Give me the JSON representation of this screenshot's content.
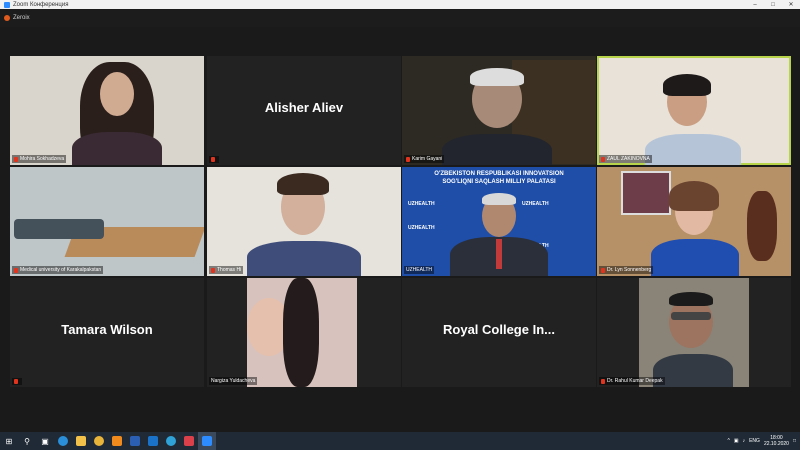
{
  "window": {
    "title": "Zoom Конференция"
  },
  "topbar": {
    "label": "Zeroix"
  },
  "participants": [
    {
      "name": "Mohira Sokhadzeva",
      "display": ""
    },
    {
      "name": "",
      "display": "Alisher Aliev"
    },
    {
      "name": "Karim Gayani",
      "display": ""
    },
    {
      "name": "ZAUL ZAKINOVNA",
      "display": ""
    },
    {
      "name": "Medical university of Karakalpakstan",
      "display": ""
    },
    {
      "name": "Thomas Hi",
      "display": ""
    },
    {
      "name": "UZHEALTH",
      "display": ""
    },
    {
      "name": "Dr. Lyn Sonnenberg",
      "display": ""
    },
    {
      "name": "",
      "display": "Tamara Wilson"
    },
    {
      "name": "Nargiza Yuldacheva",
      "display": ""
    },
    {
      "name": "",
      "display": "Royal College In..."
    },
    {
      "name": "Dr. Rahul Kumar Deepak",
      "display": ""
    }
  ],
  "banner": {
    "line1": "O'ZBEKISTON RESPUBLIKASI INNOVATSION",
    "line2": "SOG'LIQNI SAQLASH MILLIY PALATASI",
    "logo": "UZHEALTH"
  },
  "taskbar": {
    "lang": "ENG",
    "time": "18:00",
    "date": "22.10.2020"
  },
  "colors": {
    "active_outline": "#b8d44a",
    "taskbar": "#1f2a36"
  }
}
